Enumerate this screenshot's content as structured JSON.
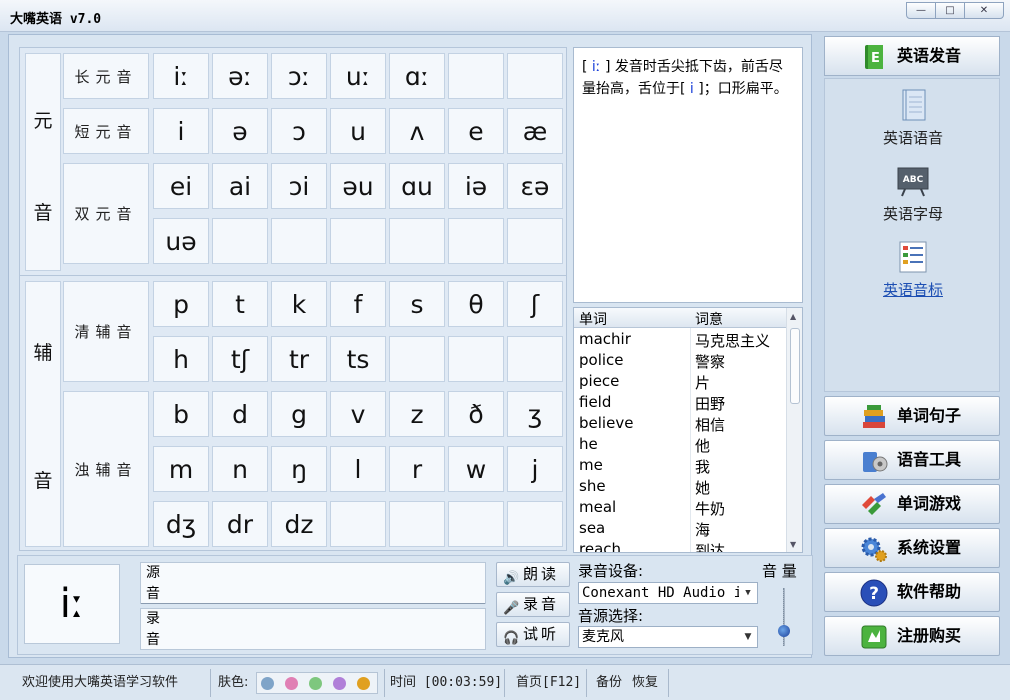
{
  "window": {
    "title": "大嘴英语 v7.0",
    "controls": [
      "—",
      "□",
      "✕"
    ]
  },
  "phonetics": {
    "vowel_label": [
      "元",
      "音"
    ],
    "consonant_label": [
      "辅",
      "音"
    ],
    "categories": {
      "long": "长元音",
      "short": "短元音",
      "diphthong": "双元音",
      "voiceless": "清辅音",
      "voiced": "浊辅音"
    },
    "rows": [
      [
        "iː",
        "əː",
        "ɔː",
        "uː",
        "ɑː",
        "",
        ""
      ],
      [
        "i",
        "ə",
        "ɔ",
        "u",
        "ʌ",
        "e",
        "æ"
      ],
      [
        "ei",
        "ai",
        "ɔi",
        "əu",
        "ɑu",
        "iə",
        "ɛə"
      ],
      [
        "uə",
        "",
        "",
        "",
        "",
        "",
        ""
      ],
      [
        "p",
        "t",
        "k",
        "f",
        "s",
        "θ",
        "ʃ"
      ],
      [
        "h",
        "tʃ",
        "tr",
        "ts",
        "",
        "",
        ""
      ],
      [
        "b",
        "d",
        "g",
        "v",
        "z",
        "ð",
        "ʒ"
      ],
      [
        "m",
        "n",
        "ŋ",
        "l",
        "r",
        "w",
        "j"
      ],
      [
        "dʒ",
        "dr",
        "dz",
        "",
        "",
        "",
        ""
      ]
    ]
  },
  "description": {
    "bracket_open": "[",
    "symbol": " iː ",
    "bracket_close": "]",
    "text1": "  发音时舌尖抵下齿，前舌尽量抬高，舌位于[",
    "symbol2": " i ",
    "text2": "]；口形扁平。"
  },
  "wordlist": {
    "headers": {
      "word": "单词",
      "meaning": "词意"
    },
    "rows": [
      {
        "word": "machir",
        "meaning": "马克思主义"
      },
      {
        "word": "police",
        "meaning": "警察"
      },
      {
        "word": "piece",
        "meaning": "片"
      },
      {
        "word": "field",
        "meaning": "田野"
      },
      {
        "word": "believe",
        "meaning": "相信"
      },
      {
        "word": "he",
        "meaning": "他"
      },
      {
        "word": "me",
        "meaning": "我"
      },
      {
        "word": "she",
        "meaning": "她"
      },
      {
        "word": "meal",
        "meaning": "牛奶"
      },
      {
        "word": "sea",
        "meaning": "海"
      },
      {
        "word": "reach",
        "meaning": "到达"
      }
    ]
  },
  "bottom": {
    "current_symbol": "iː",
    "source_label": [
      "源",
      "音"
    ],
    "record_label": [
      "录",
      "音"
    ],
    "read_button": "朗读",
    "record_button": "录音",
    "listen_button": "试听",
    "device_label": "录音设备:",
    "device_value": "Conexant HD Audio i",
    "source_select_label": "音源选择:",
    "source_value": "麦克风",
    "volume_label": "音 量",
    "volume_level": 0.2
  },
  "sidebar": {
    "header": "英语发音",
    "subitems": [
      {
        "label": "英语语音",
        "icon": "notebook-icon"
      },
      {
        "label": "英语字母",
        "icon": "abc-board-icon"
      },
      {
        "label": "英语音标",
        "icon": "list-doc-icon",
        "active": true
      }
    ],
    "buttons": [
      {
        "label": "单词句子",
        "icon": "books-icon"
      },
      {
        "label": "语音工具",
        "icon": "tools-icon"
      },
      {
        "label": "单词游戏",
        "icon": "game-icon"
      },
      {
        "label": "系统设置",
        "icon": "gear-icon"
      },
      {
        "label": "软件帮助",
        "icon": "help-icon"
      },
      {
        "label": "注册购买",
        "icon": "register-icon"
      }
    ]
  },
  "statusbar": {
    "welcome": "欢迎使用大嘴英语学习软件",
    "skin_label": "肤色:",
    "skin_colors": [
      "#7fa4c8",
      "#e07fb4",
      "#7ec77e",
      "#b07fd8",
      "#e0a020"
    ],
    "time": "时间 [00:03:59]",
    "home": "首页[F12]",
    "backup": "备份",
    "restore": "恢复"
  }
}
